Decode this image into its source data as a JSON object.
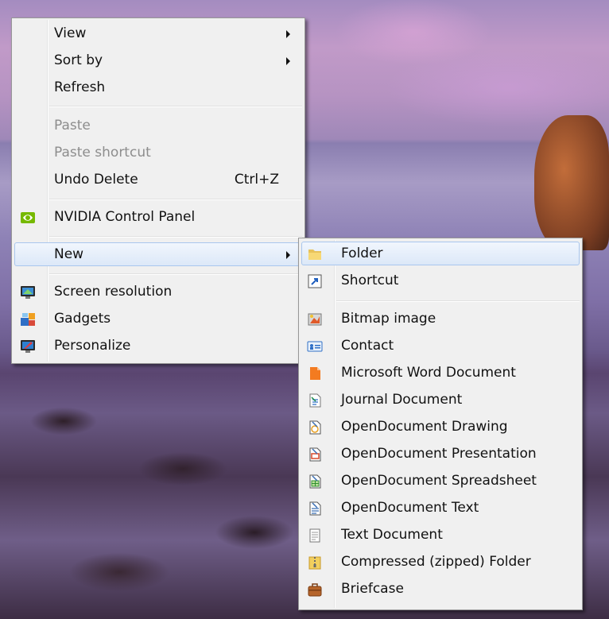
{
  "context_menu": {
    "items": [
      {
        "label": "View",
        "submenu": true
      },
      {
        "label": "Sort by",
        "submenu": true
      },
      {
        "label": "Refresh"
      },
      {
        "label": "Paste",
        "disabled": true
      },
      {
        "label": "Paste shortcut",
        "disabled": true
      },
      {
        "label": "Undo Delete",
        "shortcut": "Ctrl+Z"
      },
      {
        "label": "NVIDIA Control Panel",
        "icon": "nvidia-icon"
      },
      {
        "label": "New",
        "submenu": true,
        "highlighted": true
      },
      {
        "label": "Screen resolution",
        "icon": "screen-resolution-icon"
      },
      {
        "label": "Gadgets",
        "icon": "gadgets-icon"
      },
      {
        "label": "Personalize",
        "icon": "personalize-icon"
      }
    ]
  },
  "new_submenu": {
    "items": [
      {
        "label": "Folder",
        "icon": "folder-icon",
        "highlighted": true
      },
      {
        "label": "Shortcut",
        "icon": "shortcut-icon"
      },
      {
        "label": "Bitmap image",
        "icon": "bitmap-icon"
      },
      {
        "label": "Contact",
        "icon": "contact-icon"
      },
      {
        "label": "Microsoft Word Document",
        "icon": "word-document-icon"
      },
      {
        "label": "Journal Document",
        "icon": "journal-document-icon"
      },
      {
        "label": "OpenDocument Drawing",
        "icon": "opendocument-drawing-icon"
      },
      {
        "label": "OpenDocument Presentation",
        "icon": "opendocument-presentation-icon"
      },
      {
        "label": "OpenDocument Spreadsheet",
        "icon": "opendocument-spreadsheet-icon"
      },
      {
        "label": "OpenDocument Text",
        "icon": "opendocument-text-icon"
      },
      {
        "label": "Text Document",
        "icon": "text-document-icon"
      },
      {
        "label": "Compressed (zipped) Folder",
        "icon": "zip-folder-icon"
      },
      {
        "label": "Briefcase",
        "icon": "briefcase-icon"
      }
    ]
  },
  "colors": {
    "menu_background": "#f0f0f0",
    "highlight_border": "#a9c6ee",
    "disabled_text": "#8d8d8d"
  }
}
